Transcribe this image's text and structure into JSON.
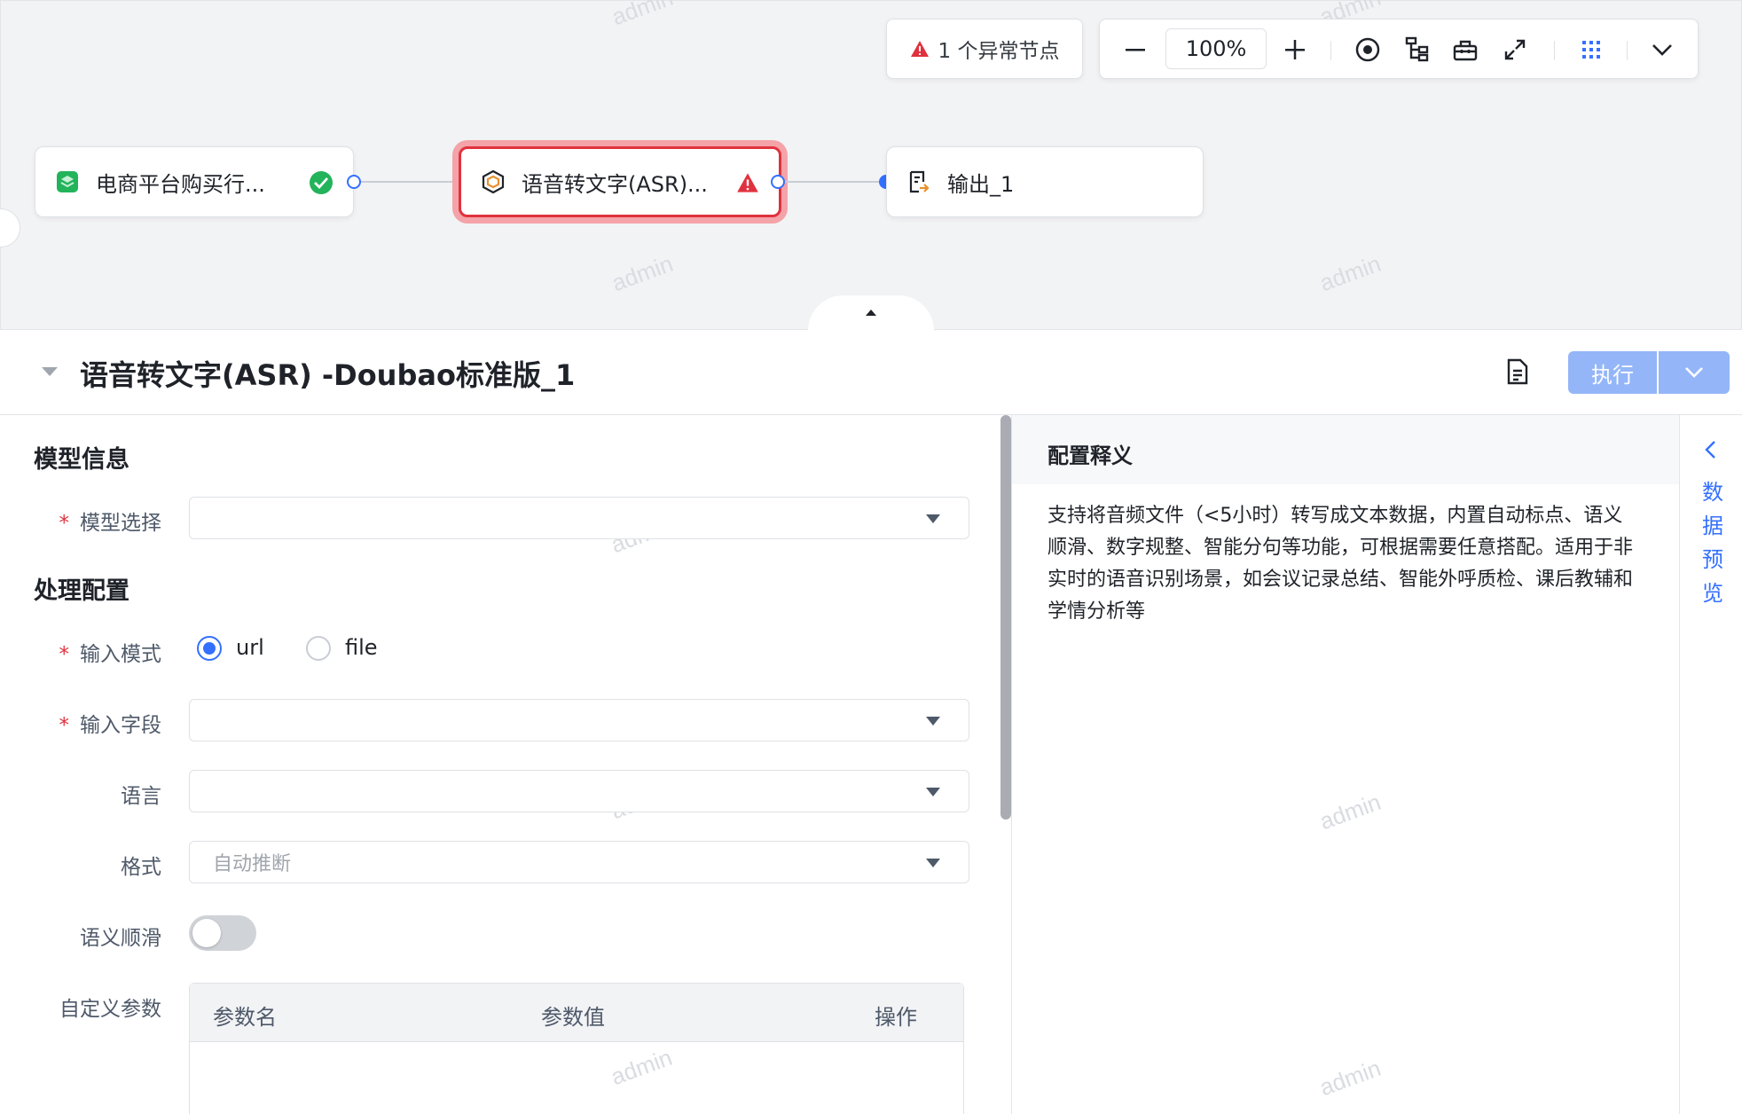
{
  "canvas": {
    "alert": {
      "count_text": "1 个异常节点"
    },
    "toolbar": {
      "zoom": "100%"
    },
    "nodes": [
      {
        "label": "电商平台购买行...",
        "status": "success"
      },
      {
        "label": "语音转文字(ASR)...",
        "status": "error"
      },
      {
        "label": "输出_1",
        "status": "none"
      }
    ],
    "watermark": "admin"
  },
  "panel": {
    "title": "语音转文字(ASR) -Doubao标准版_1",
    "run_label": "执行"
  },
  "form": {
    "model_section": "模型信息",
    "model_select_label": "模型选择",
    "process_section": "处理配置",
    "input_mode_label": "输入模式",
    "input_mode_options": [
      "url",
      "file"
    ],
    "input_mode_selected": "url",
    "input_field_label": "输入字段",
    "language_label": "语言",
    "format_label": "格式",
    "format_placeholder": "自动推断",
    "smooth_label": "语义顺滑",
    "smooth_on": false,
    "custom_params_label": "自定义参数",
    "params_headers": [
      "参数名",
      "参数值",
      "操作"
    ]
  },
  "help": {
    "title": "配置释义",
    "text": "支持将音频文件（<5小时）转写成文本数据，内置自动标点、语义顺滑、数字规整、智能分句等功能，可根据需要任意搭配。适用于非实时的语音识别场景，如会议记录总结、智能外呼质检、课后教辅和学情分析等"
  },
  "side": {
    "label": "数据预览"
  },
  "colors": {
    "accent": "#3370ff",
    "error": "#e0323e",
    "success": "#23b35b",
    "run_btn": "#94b6f8"
  }
}
